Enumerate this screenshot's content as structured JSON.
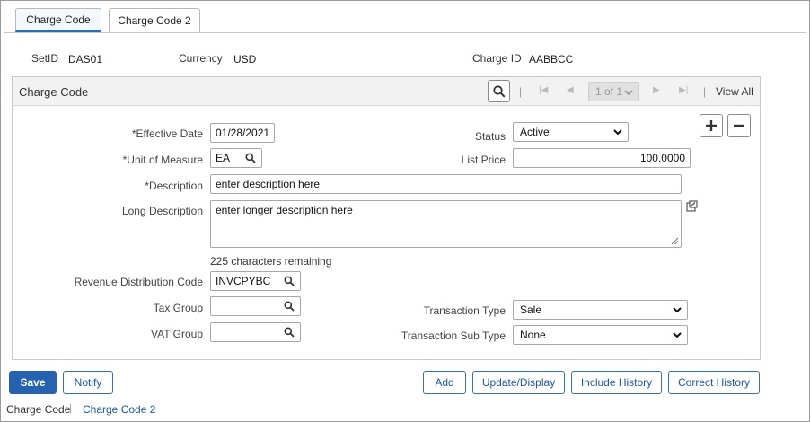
{
  "tabs": [
    {
      "label": "Charge Code",
      "active": true
    },
    {
      "label": "Charge Code 2",
      "active": false
    }
  ],
  "header": {
    "setid_label": "SetID",
    "setid_value": "DAS01",
    "currency_label": "Currency",
    "currency_value": "USD",
    "chargeid_label": "Charge ID",
    "chargeid_value": "AABBCC"
  },
  "panel": {
    "title": "Charge Code",
    "pager": {
      "first": "|◀",
      "prev": "◀",
      "range": "1 of 1",
      "next": "▶",
      "last": "▶|",
      "view_all": "View All",
      "separator": "|"
    }
  },
  "form": {
    "effective_date_label": "*Effective Date",
    "effective_date_value": "01/28/2021",
    "status_label": "Status",
    "status_value": "Active",
    "uom_label": "*Unit of Measure",
    "uom_value": "EA",
    "list_price_label": "List Price",
    "list_price_value": "100.0000",
    "description_label": "*Description",
    "description_value": "enter description here",
    "long_description_label": "Long Description",
    "long_description_value": "enter longer description here",
    "chars_remaining": "225 characters remaining",
    "rev_dist_label": "Revenue Distribution Code",
    "rev_dist_value": "INVCPYBC",
    "tax_group_label": "Tax Group",
    "tax_group_value": "",
    "vat_group_label": "VAT Group",
    "vat_group_value": "",
    "transaction_type_label": "Transaction Type",
    "transaction_type_value": "Sale",
    "transaction_subtype_label": "Transaction Sub Type",
    "transaction_subtype_value": "None"
  },
  "buttons": {
    "save": "Save",
    "notify": "Notify",
    "add": "Add",
    "update_display": "Update/Display",
    "include_history": "Include History",
    "correct_history": "Correct History"
  },
  "footer": {
    "current": "Charge Code",
    "separator": "|",
    "link": "Charge Code 2"
  },
  "colors": {
    "accent": "#2563b0",
    "link": "#1f56a6"
  }
}
